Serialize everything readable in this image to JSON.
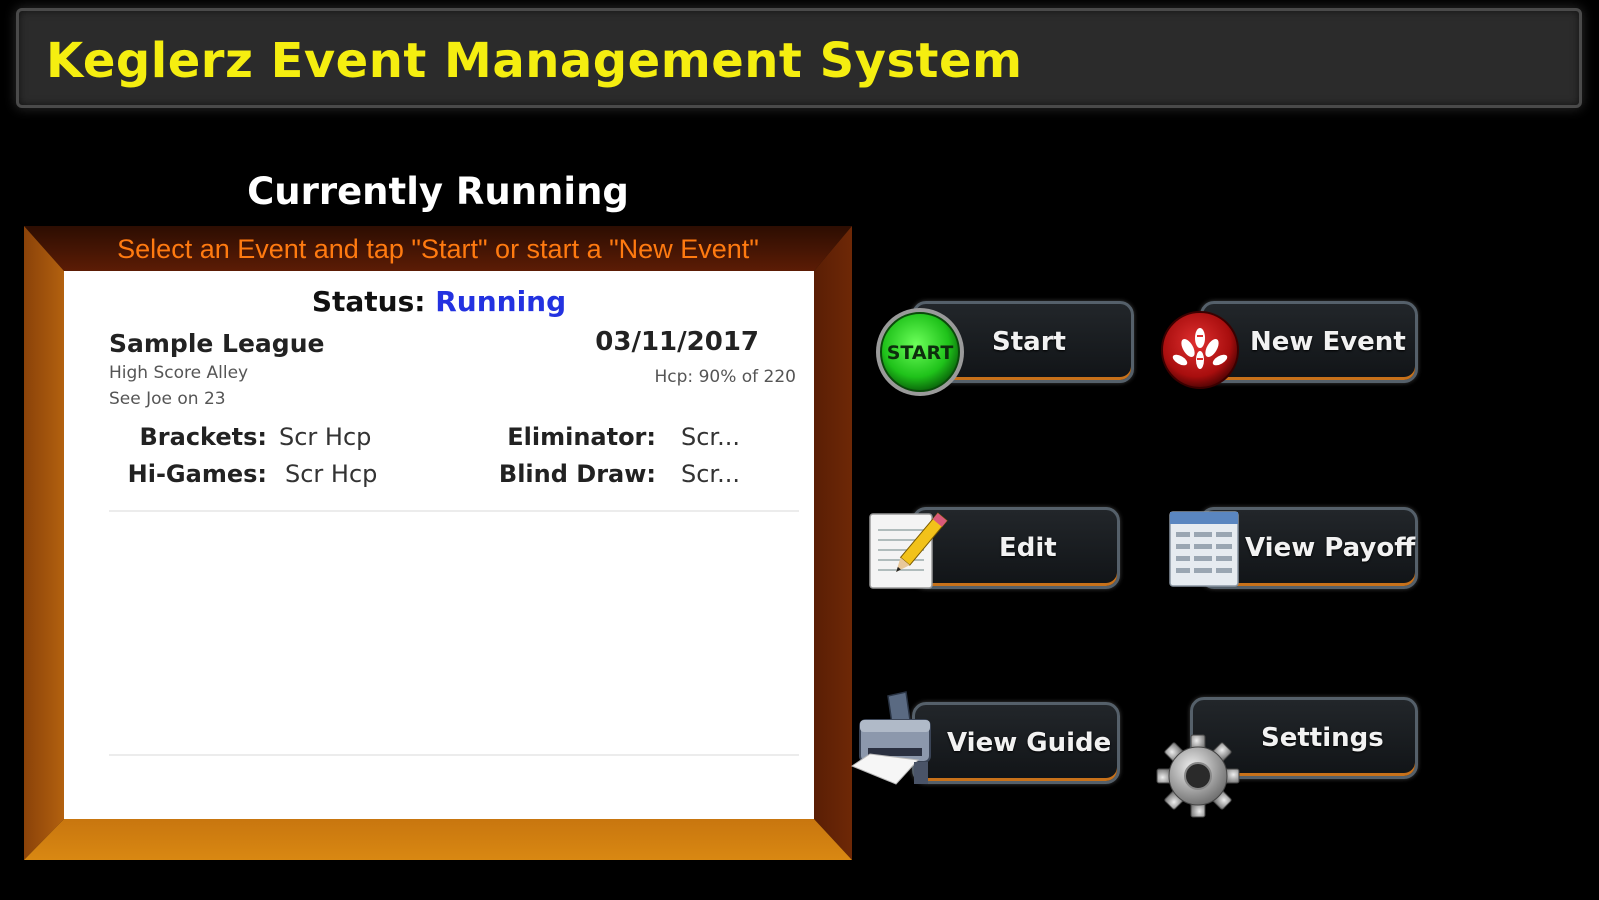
{
  "header": {
    "title": "Keglerz Event Management System"
  },
  "panel": {
    "title": "Currently Running",
    "instruction": "Select an Event and tap \"Start\" or start a \"New Event\"",
    "status_label": "Status:",
    "status_value": "Running",
    "event": {
      "name": "Sample League",
      "location": "High Score Alley",
      "note": "See Joe on 23",
      "date": "03/11/2017",
      "handicap": "Hcp: 90% of 220"
    },
    "details": {
      "brackets_label": "Brackets:",
      "brackets_value": "Scr Hcp",
      "hi_games_label": "Hi-Games:",
      "hi_games_value": "Scr Hcp",
      "eliminator_label": "Eliminator:",
      "eliminator_value": "Scr...",
      "blind_draw_label": "Blind Draw:",
      "blind_draw_value": "Scr..."
    }
  },
  "buttons": {
    "start": {
      "label": "Start",
      "icon": "start-icon",
      "icon_text": "START"
    },
    "new_event": {
      "label": "New Event",
      "icon": "bowling-pins-icon"
    },
    "edit": {
      "label": "Edit",
      "icon": "pencil-notepad-icon"
    },
    "view_payoff": {
      "label": "View Payoff",
      "icon": "document-icon"
    },
    "view_guide": {
      "label": "View Guide",
      "icon": "printer-icon"
    },
    "settings": {
      "label": "Settings",
      "icon": "gear-icon"
    }
  },
  "colors": {
    "title_yellow": "#f5ee10",
    "instruction_orange": "#ff7a10",
    "status_blue": "#2332e0",
    "frame_brown": "#a4550e",
    "button_accent": "#c7711a"
  }
}
